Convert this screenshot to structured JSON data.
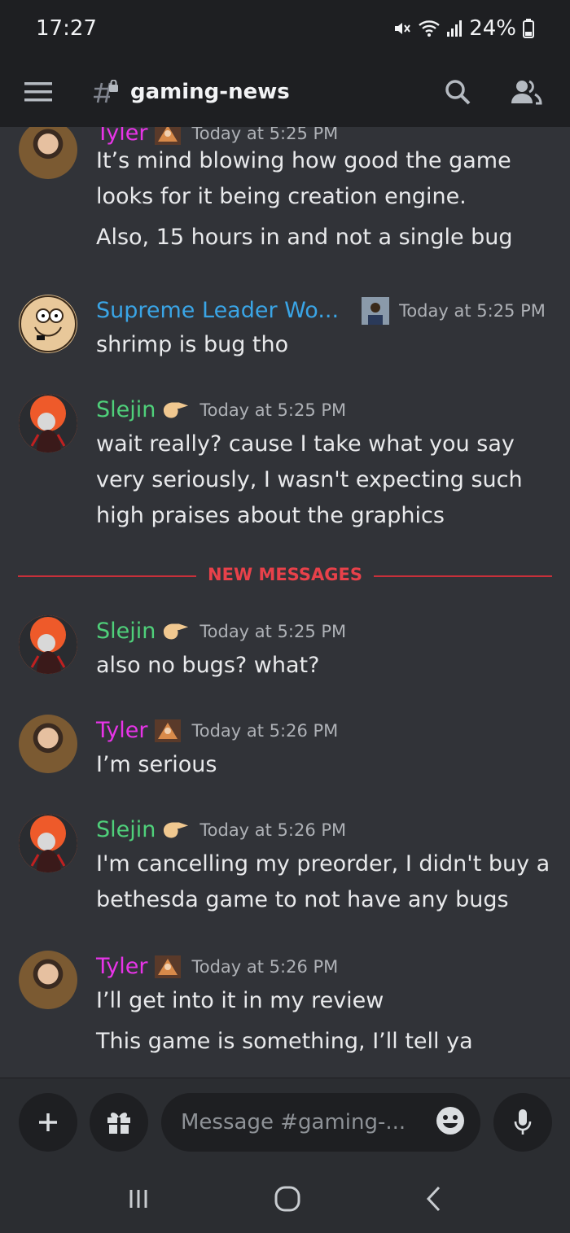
{
  "status_bar": {
    "time": "17:27",
    "battery": "24%"
  },
  "header": {
    "channel": "gaming-news"
  },
  "messages": [
    {
      "user": "Tyler",
      "time": "Today at 5:25 PM",
      "lines": [
        "It’s mind blowing how good the game",
        "looks for it being creation engine.",
        "Also, 15 hours in and not a single bug"
      ]
    },
    {
      "user": "Supreme Leader Wo...",
      "time": "Today at 5:25 PM",
      "lines": [
        "shrimp is bug tho"
      ]
    },
    {
      "user": "Slejin",
      "time": "Today at 5:25 PM",
      "lines": [
        "wait really? cause I take what you say",
        "very seriously, I wasn't expecting such",
        "high praises about the graphics"
      ]
    },
    {
      "user": "Slejin",
      "time": "Today at 5:25 PM",
      "lines": [
        "also no bugs? what?"
      ]
    },
    {
      "user": "Tyler",
      "time": "Today at 5:26 PM",
      "lines": [
        "I’m serious"
      ]
    },
    {
      "user": "Slejin",
      "time": "Today at 5:26 PM",
      "lines": [
        "I'm cancelling my preorder, I didn't buy a",
        "bethesda game to not have any bugs"
      ]
    },
    {
      "user": "Tyler",
      "time": "Today at 5:26 PM",
      "lines": [
        "I’ll get into it in my review",
        "This game is something, I’ll tell ya"
      ]
    }
  ],
  "divider": {
    "label": "NEW MESSAGES"
  },
  "composer": {
    "placeholder": "Message #gaming-..."
  },
  "colors": {
    "tyler": "#e834e8",
    "supreme": "#3aa5e6",
    "slejin": "#4fd07a",
    "new_messages": "#e8414a"
  }
}
